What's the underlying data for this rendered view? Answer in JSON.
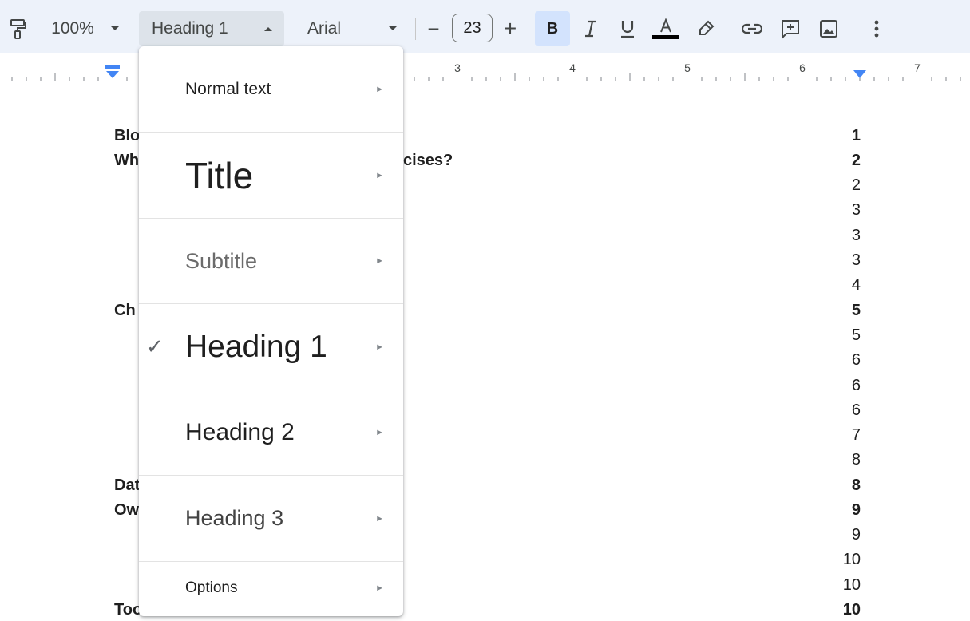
{
  "toolbar": {
    "zoom": "100%",
    "style": "Heading 1",
    "font": "Arial",
    "font_size": "23",
    "decrease_size": "−",
    "increase_size": "+",
    "bold": "B"
  },
  "ruler": {
    "numbers": [
      "3",
      "4",
      "5",
      "6",
      "7"
    ]
  },
  "menu": {
    "items": [
      {
        "label": "Normal text"
      },
      {
        "label": "Title"
      },
      {
        "label": "Subtitle"
      },
      {
        "label": "Heading 1",
        "checked": true
      },
      {
        "label": "Heading 2"
      },
      {
        "label": "Heading 3"
      },
      {
        "label": "Options"
      }
    ],
    "arrow": "►",
    "check": "✓"
  },
  "document": {
    "lines": [
      {
        "text": "Blo"
      },
      {
        "text": "Wh"
      },
      {
        "text": "cises?"
      },
      {
        "text": "Ch"
      },
      {
        "text": "Dat"
      },
      {
        "text": "Ow"
      },
      {
        "text": "Too"
      }
    ],
    "page_numbers": [
      {
        "value": "1",
        "bold": true
      },
      {
        "value": "2",
        "bold": true
      },
      {
        "value": "2",
        "bold": false
      },
      {
        "value": "3",
        "bold": false
      },
      {
        "value": "3",
        "bold": false
      },
      {
        "value": "3",
        "bold": false
      },
      {
        "value": "4",
        "bold": false
      },
      {
        "value": "5",
        "bold": true
      },
      {
        "value": "5",
        "bold": false
      },
      {
        "value": "6",
        "bold": false
      },
      {
        "value": "6",
        "bold": false
      },
      {
        "value": "6",
        "bold": false
      },
      {
        "value": "7",
        "bold": false
      },
      {
        "value": "8",
        "bold": false
      },
      {
        "value": "8",
        "bold": true
      },
      {
        "value": "9",
        "bold": true
      },
      {
        "value": "9",
        "bold": false
      },
      {
        "value": "10",
        "bold": false
      },
      {
        "value": "10",
        "bold": false
      },
      {
        "value": "10",
        "bold": true
      }
    ]
  },
  "colors": {
    "toolbar_bg": "#edf2fa",
    "style_box_bg": "#dde3ea",
    "bold_active_bg": "#d3e3fd",
    "ruler_marker": "#4285f4"
  }
}
